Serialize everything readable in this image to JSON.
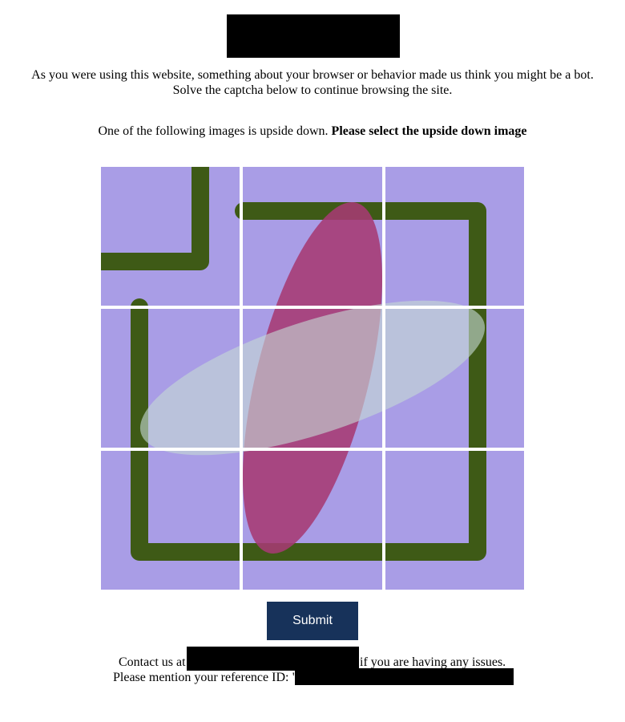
{
  "intro": {
    "line1": "As you were using this website, something about your browser or behavior made us think you might be a bot.",
    "line2": "Solve the captcha below to continue browsing the site."
  },
  "instruction": {
    "text": "One of the following images is upside down.",
    "emphasis": "Please select the upside down image"
  },
  "captcha": {
    "tiles": [
      "tile-1",
      "tile-2",
      "tile-3",
      "tile-4",
      "tile-5",
      "tile-6",
      "tile-7",
      "tile-8",
      "tile-9"
    ],
    "colors": {
      "background": "#a99de6",
      "frame": "#3e5a16",
      "red_ellipse": "#a63a73",
      "light_ellipse": "#c5d8d3",
      "separator": "#ffffff"
    }
  },
  "submit": {
    "label": "Submit",
    "color": "#17325a"
  },
  "footer": {
    "contact_prefix": "Contact us at",
    "contact_suffix": "if you are having any issues.",
    "reference_prefix": "Please mention your reference ID: \""
  }
}
